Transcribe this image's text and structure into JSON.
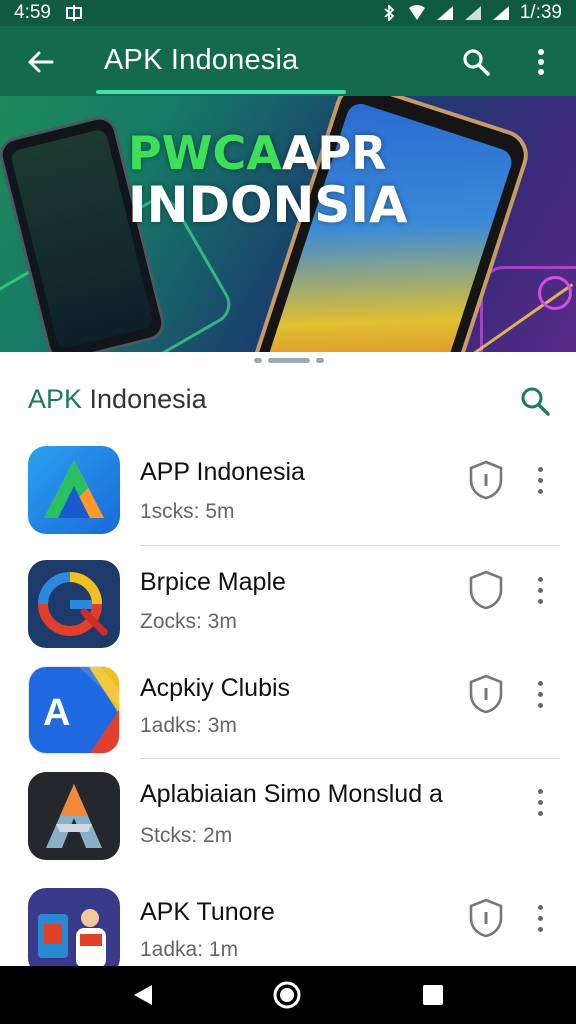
{
  "status_bar": {
    "time_left": "4:59",
    "time_right": "1/:39",
    "left_icon": "notification-icon"
  },
  "app_bar": {
    "title": "APK Indonesia",
    "back_icon": "arrow-back-icon",
    "search_icon": "search-icon",
    "more_icon": "more-vert-icon"
  },
  "banner": {
    "line1_green": "PWCA",
    "line1_white": "APR",
    "line2": "INDONSIA"
  },
  "list": {
    "header_accent": "APK",
    "header_rest": " Indonesia",
    "items": [
      {
        "name": "APP Indonesia",
        "sub": "1scks: 5m",
        "shield": "info"
      },
      {
        "name": "Brpice Maple",
        "sub": "Zocks: 3m",
        "shield": "plain"
      },
      {
        "name": "Acpkiy Clubis",
        "sub": "1adks: 3m",
        "shield": "info"
      },
      {
        "name": "Aplabiaian Simo Monslud a",
        "sub": "Stcks: 2m",
        "shield": "none"
      },
      {
        "name": "APK Tunore",
        "sub": "1adka: 1m",
        "shield": "info"
      }
    ]
  },
  "colors": {
    "app_bar": "#136a4c",
    "status_bar": "#0f5a40",
    "accent": "#1d7a60"
  },
  "nav": {
    "back_icon": "triangle-back-icon",
    "home_icon": "circle-home-icon",
    "recents_icon": "square-recents-icon"
  }
}
